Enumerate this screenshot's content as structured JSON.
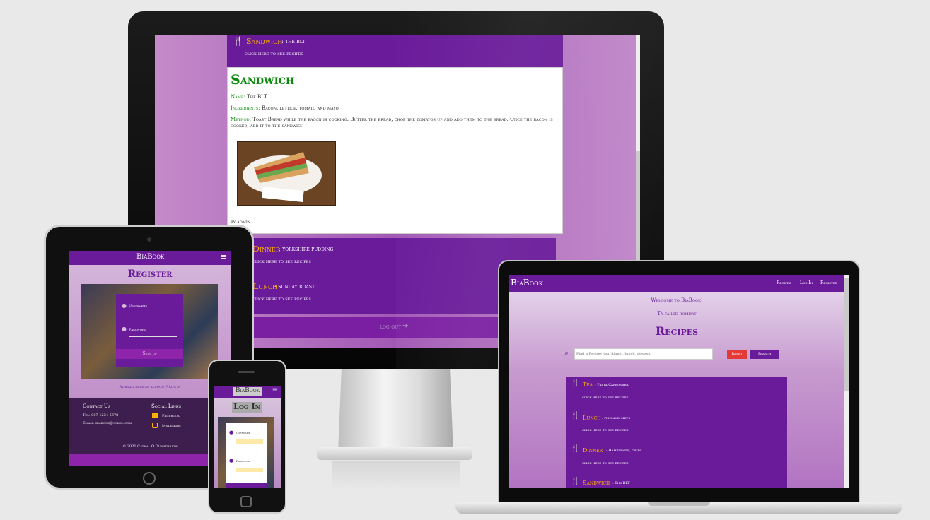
{
  "desktop": {
    "top_row": {
      "meal": "Sandwich",
      "dish": ": the blt",
      "link": "click here to see recipes"
    },
    "recipe": {
      "title": "Sandwich",
      "name_label": "Name:",
      "name_value": "The BLT",
      "ingredients_label": "Ingredients:",
      "ingredients_value": "Bacon, lettice, tomato and mayo",
      "method_label": "Method:",
      "method_value": "Toast Bread while the bacon is cooking. Butter the bread, chop the tomatos up and add them to the bread. Once the bacon is cooked, add it to the sandwich",
      "byline": "by admin"
    },
    "rows": [
      {
        "meal": "Dinner",
        "dish": ": yorkshire pudding",
        "link": "click here to see recipes"
      },
      {
        "meal": "Lunch",
        "dish": ": sunday roast",
        "link": "click here to see recipes"
      }
    ],
    "footer_link": "log out"
  },
  "tablet": {
    "brand": "BiaBook",
    "page_title": "Register",
    "form": {
      "username_label": "Username",
      "password_label": "Password",
      "button": "Sign up"
    },
    "note": "Already have an account? Log in",
    "footer": {
      "contact_title": "Contact Us",
      "phone": "Tel: 087 1234 5678",
      "email": "Email: biabook@gmail.com",
      "social_title": "Social Links",
      "facebook": "Facebook",
      "instagram": "Instagram",
      "copyright": "© 2021 Cathal Ó Dubhthaigh"
    }
  },
  "phone": {
    "brand": "BiaBook",
    "page_title": "Log In",
    "form": {
      "username_label": "Username",
      "password_label": "Password"
    }
  },
  "laptop": {
    "brand": "BiaBook",
    "nav": [
      "Recipes",
      "Log In",
      "Register"
    ],
    "welcome": "Welcome to BiaBook!",
    "welcome_irish": "Tá fáilte romhat",
    "page_title": "Recipes",
    "search": {
      "placeholder": "Find a Recipe: tea, dinner, lunch, dessert",
      "reset": "Reset",
      "search": "Search"
    },
    "rows": [
      {
        "meal": "Tea",
        "dish": ": Pasta Carbonara",
        "link": "click here to see recipes"
      },
      {
        "meal": "Lunch",
        "dish": ": fish and chips",
        "link": "click here to see recipes"
      },
      {
        "meal": "Dinner",
        "dish": ": Hamburger, chips",
        "link": "click here to see recipes"
      },
      {
        "meal": "Sandwich",
        "dish": ": The BLT",
        "link": ""
      }
    ]
  },
  "colors": {
    "purple": "#6a1b9a",
    "gold": "#ffb300",
    "green": "#0a8a0a",
    "red": "#e53935"
  }
}
